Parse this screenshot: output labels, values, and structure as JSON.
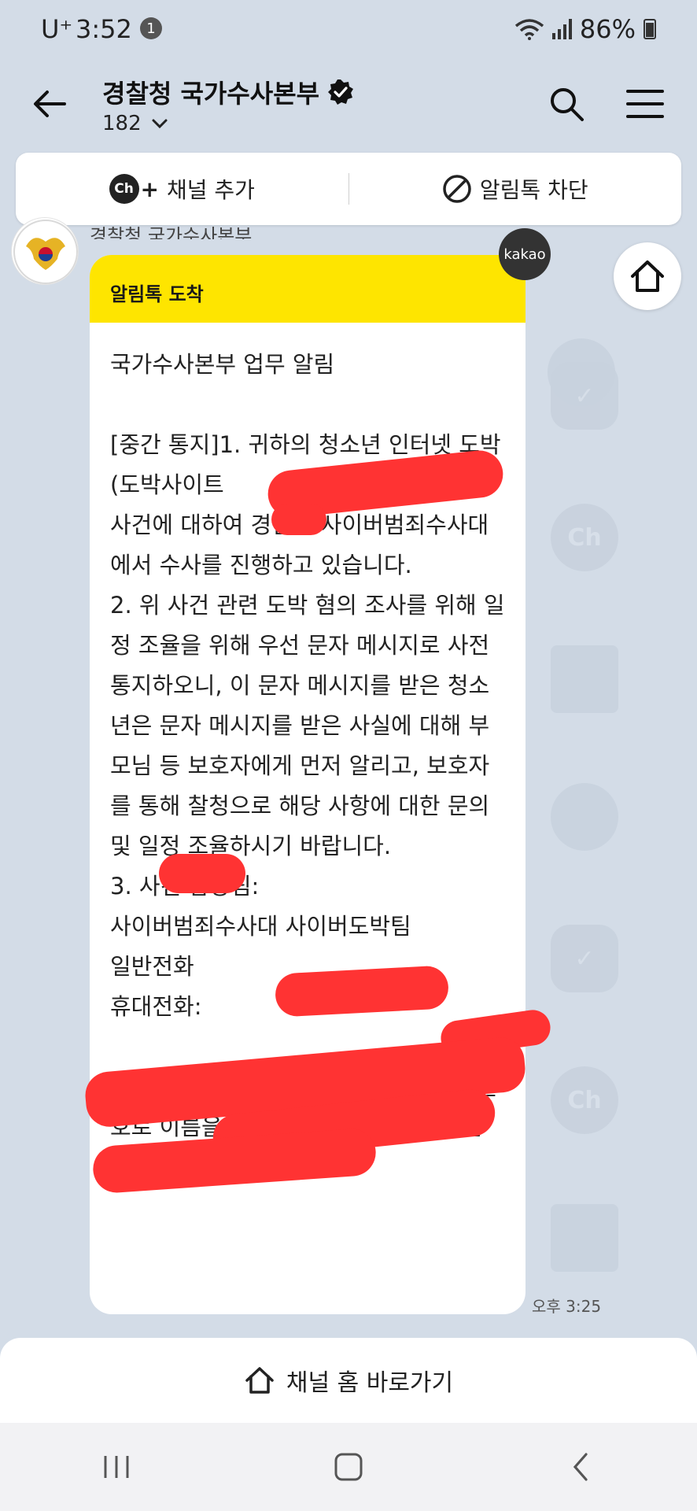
{
  "status_bar": {
    "carrier": "U⁺",
    "time": "3:52",
    "notification_count": "1",
    "battery": "86%"
  },
  "header": {
    "channel_name": "경찰청 국가수사본부",
    "follower_count": "182",
    "icons": [
      "back-arrow-icon",
      "verified-check-icon",
      "chevron-down-icon",
      "search-icon",
      "menu-icon"
    ]
  },
  "actions": {
    "add_channel": "채널 추가",
    "ch_badge": "Ch",
    "block_alimtalk": "알림톡 차단"
  },
  "message": {
    "sender": "경찰청 국가수사본부",
    "header": "알림톡 도착",
    "badge": "kakao",
    "body": "국가수사본부 업무 알림\n\n[중간 통지]1. 귀하의 청소년 인터넷 도박(도박사이트\n사건에 대하여 경찰청 사이버범죄수사대에서 수사를 진행하고 있습니다.\n2. 위 사건 관련 도박 혐의 조사를 위해 일정 조율을 위해 우선 문자 메시지로 사전 통지하오니, 이 문자 메시지를 받은 청소년은 문자 메시지를 받은 사실에 대해 부모님 등 보호자에게 먼저 알리고, 보호자를 통해 찰청으로 해당 사항에 대한 문의 및 일정 조율하시기 바랍니다.\n3. 사건 담당팀:\n사이버범죄수사대 사이버도박팀\n일반전화\n휴대전화:\n\n4. 통화연결 되지 않을 시 위 휴대전화 번호로 이름을 문자 메시지로 남겨 주시면 확인 후 전화하겠습니다.",
    "time": "오후 3:25"
  },
  "bottom": {
    "channel_home": "채널 홈 바로가기"
  },
  "colors": {
    "background": "#d3dce7",
    "alimtalk_yellow": "#fee500",
    "redaction": "#ff3333"
  }
}
